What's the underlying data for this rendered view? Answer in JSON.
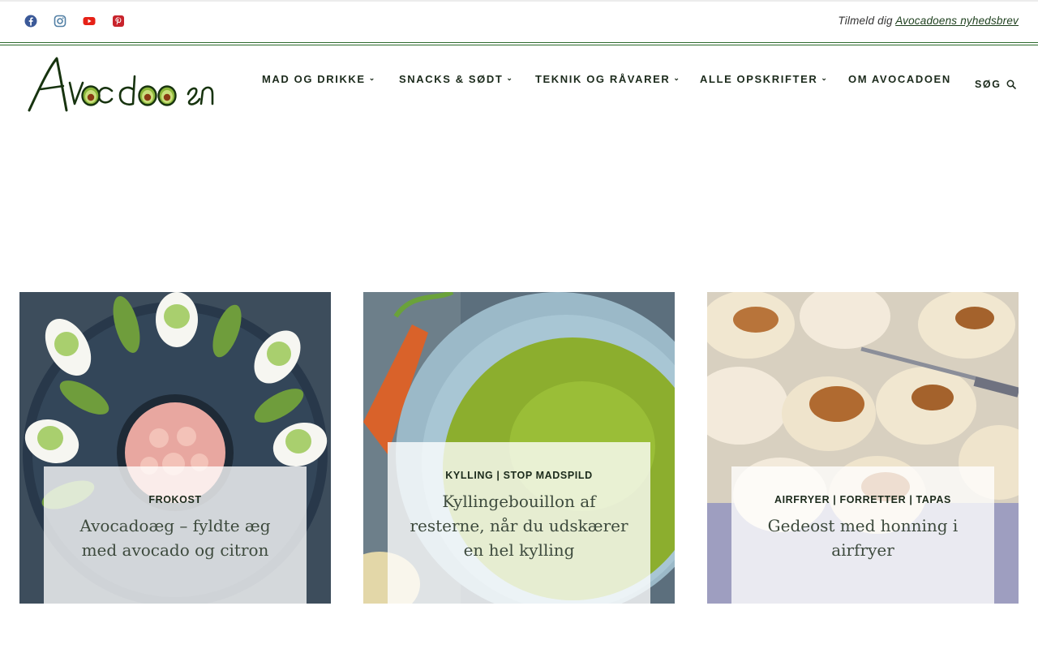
{
  "topbar": {
    "social": [
      {
        "name": "facebook-icon",
        "color": "#3b5998"
      },
      {
        "name": "instagram-icon",
        "color": "#517fa4"
      },
      {
        "name": "youtube-icon",
        "color": "#e62117"
      },
      {
        "name": "pinterest-icon",
        "color": "#c8232c"
      }
    ],
    "newsletter_prefix": "Tilmeld dig ",
    "newsletter_link": "Avocadoens nyhedsbrev"
  },
  "header": {
    "logo_text": "Avocadoen",
    "nav": [
      {
        "label": "MAD OG DRIKKE",
        "has_dropdown": true
      },
      {
        "label": "SNACKS & SØDT",
        "has_dropdown": true
      },
      {
        "label": "TEKNIK OG RÅVARER",
        "has_dropdown": true
      },
      {
        "label": "ALLE OPSKRIFTER",
        "has_dropdown": true
      },
      {
        "label": "OM AVOCADOEN",
        "has_dropdown": false
      }
    ],
    "search_label": "SØG"
  },
  "cards": [
    {
      "category": "FROKOST",
      "title": "Avocadoæg – fyldte æg med avocado og citron"
    },
    {
      "category": "KYLLING | STOP MADSPILD",
      "title": "Kyllingebouillon af resterne, når du udskærer en hel kylling"
    },
    {
      "category": "AIRFRYER | FORRETTER | TAPAS",
      "title": "Gedeost med honning i airfryer"
    }
  ],
  "colors": {
    "accent_green": "#2d6a2d",
    "nav_text": "#1b2a1b"
  }
}
